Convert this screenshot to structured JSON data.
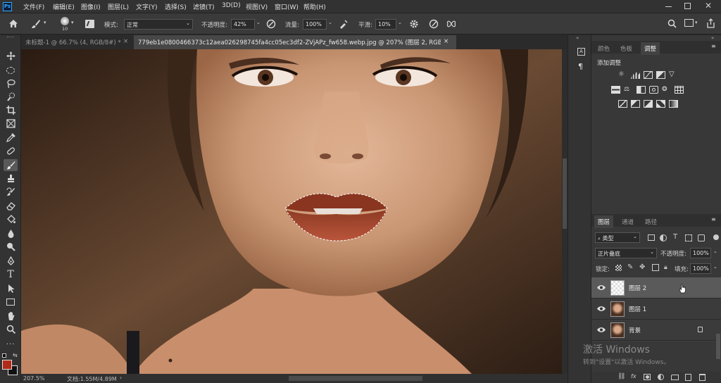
{
  "menu": [
    "文件(F)",
    "编辑(E)",
    "图像(I)",
    "图层(L)",
    "文字(Y)",
    "选择(S)",
    "滤镜(T)",
    "3D(D)",
    "视图(V)",
    "窗口(W)",
    "帮助(H)"
  ],
  "options": {
    "brush_size": "10",
    "mode_label": "模式:",
    "mode_value": "正常",
    "opacity_label": "不透明度:",
    "opacity_value": "42%",
    "flow_label": "流量:",
    "flow_value": "100%",
    "smooth_label": "平滑:",
    "smooth_value": "10%"
  },
  "tabs": [
    {
      "label": "未标题-1 @ 66.7% (4, RGB/8#) *",
      "active": false
    },
    {
      "label": "779eb1e0800466373c12aea026298745fa4cc05ec3df2-ZVjAPz_fw658.webp.jpg @ 207% (图层 2, RGB/8#) *",
      "active": true
    }
  ],
  "status": {
    "zoom": "207.5%",
    "doc": "文档:1.55M/4.89M"
  },
  "panel_tabs_top": [
    "颜色",
    "色板",
    "调整"
  ],
  "adjust": {
    "title": "添加调整"
  },
  "layers_panel": {
    "tabs": [
      "图层",
      "通道",
      "路径"
    ],
    "filter_label": "类型",
    "blend_mode": "正片叠底",
    "opacity_label": "不透明度:",
    "opacity_value": "100%",
    "lock_label": "锁定:",
    "fill_label": "填充:",
    "fill_value": "100%",
    "layers": [
      {
        "name": "图层 2",
        "selected": true
      },
      {
        "name": "图层 1",
        "selected": false
      },
      {
        "name": "背景",
        "selected": false
      }
    ]
  },
  "watermark": {
    "line1": "激活 Windows",
    "line2": "转到\"设置\"以激活 Windows。"
  },
  "colors": {
    "foreground": "#b22a18",
    "background": "#111111",
    "app_bg": "#323232",
    "selected_layer": "#5a5a5a"
  }
}
